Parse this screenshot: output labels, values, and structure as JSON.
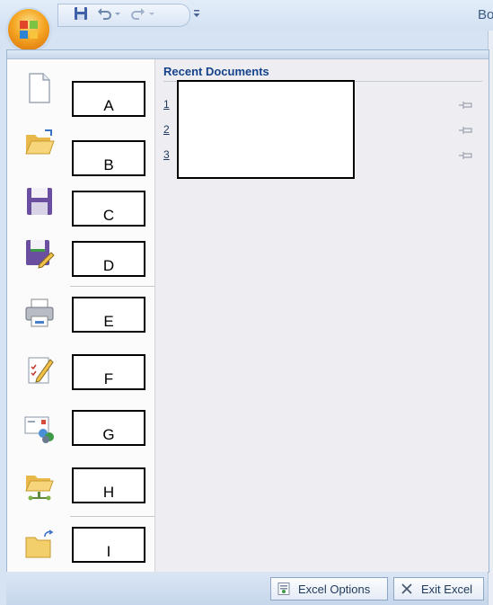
{
  "window": {
    "title_fragment": "Bo"
  },
  "quick_access_toolbar": {
    "icons": [
      "save-icon",
      "undo-icon",
      "redo-icon",
      "customize-dropdown-icon"
    ]
  },
  "office_button": {
    "icon": "office-logo-icon"
  },
  "menu": {
    "commands": [
      {
        "id": "new",
        "icon": "new-document-icon",
        "label": "A"
      },
      {
        "id": "open",
        "icon": "open-folder-icon",
        "label": "B"
      },
      {
        "id": "save",
        "icon": "save-disk-icon",
        "label": "C"
      },
      {
        "id": "save-as",
        "icon": "save-as-icon",
        "label": "D"
      },
      {
        "id": "print",
        "icon": "printer-icon",
        "label": "E"
      },
      {
        "id": "prepare",
        "icon": "prepare-document-icon",
        "label": "F"
      },
      {
        "id": "send",
        "icon": "send-icon",
        "label": "G"
      },
      {
        "id": "publish",
        "icon": "publish-folder-icon",
        "label": "H"
      },
      {
        "id": "close",
        "icon": "close-folder-icon",
        "label": "I"
      }
    ],
    "recent_documents": {
      "heading": "Recent Documents",
      "items": [
        {
          "number": "1",
          "pin_icon": "pin-icon"
        },
        {
          "number": "2",
          "pin_icon": "pin-icon"
        },
        {
          "number": "3",
          "pin_icon": "pin-icon"
        }
      ]
    }
  },
  "footer": {
    "options_label": "Excel Options",
    "exit_label": "Exit Excel"
  },
  "colors": {
    "accent_blue": "#15428b",
    "frame_blue": "#d6e3f3",
    "office_orange": "#f5a623"
  }
}
